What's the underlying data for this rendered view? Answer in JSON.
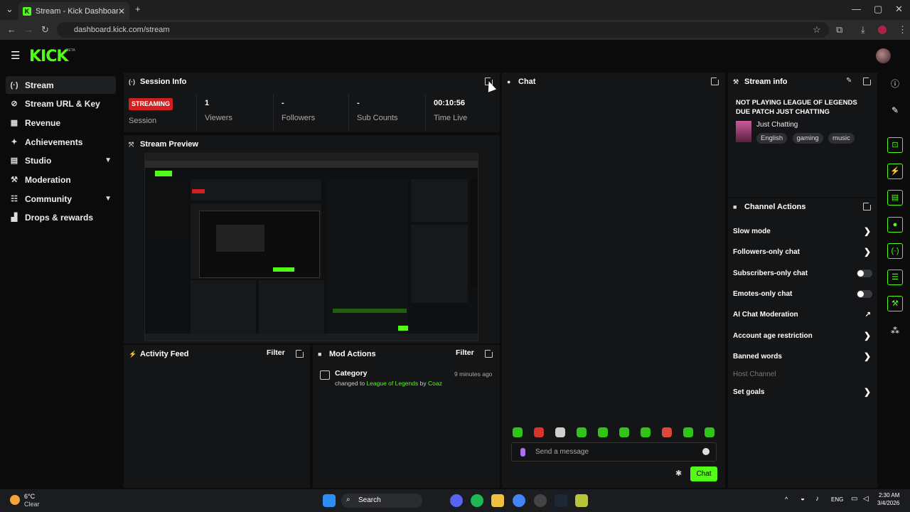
{
  "browser": {
    "tab_title": "Stream - Kick Dashboard",
    "url": "dashboard.kick.com/stream"
  },
  "app": {
    "logo": "KICK",
    "beta": "BETA"
  },
  "sidebar": {
    "items": [
      {
        "label": "Stream",
        "icon": "broadcast-icon"
      },
      {
        "label": "Stream URL & Key",
        "icon": "link-icon"
      },
      {
        "label": "Revenue",
        "icon": "revenue-icon"
      },
      {
        "label": "Achievements",
        "icon": "trophy-icon"
      },
      {
        "label": "Studio",
        "icon": "studio-icon"
      },
      {
        "label": "Moderation",
        "icon": "wrench-icon"
      },
      {
        "label": "Community",
        "icon": "community-icon"
      },
      {
        "label": "Drops & rewards",
        "icon": "gift-icon"
      }
    ]
  },
  "session": {
    "title": "Session Info",
    "status": "STREAMING",
    "status_label": "Session",
    "viewers_value": "1",
    "viewers_label": "Viewers",
    "followers_value": "-",
    "followers_label": "Followers",
    "subs_value": "-",
    "subs_label": "Sub Counts",
    "time_value": "00:10:56",
    "time_label": "Time Live"
  },
  "preview": {
    "title": "Stream Preview"
  },
  "activity": {
    "title": "Activity Feed",
    "filter": "Filter"
  },
  "mod_actions": {
    "title": "Mod Actions",
    "filter": "Filter",
    "entry_title": "Category",
    "entry_time": "9 minutes ago",
    "entry_prefix": "changed to",
    "entry_game": "League of Legends",
    "entry_by": "by",
    "entry_user": "Coaz"
  },
  "chat": {
    "title": "Chat",
    "placeholder": "Send a message",
    "send": "Chat"
  },
  "stream_info": {
    "title": "Stream info",
    "stream_title": "NOT PLAYING LEAGUE OF LEGENDS DUE PATCH JUST CHATTING",
    "category": "Just Chatting",
    "tags": [
      "English",
      "gaming",
      "music"
    ]
  },
  "channel_actions": {
    "title": "Channel Actions",
    "items": [
      {
        "label": "Slow mode",
        "control": "chevron"
      },
      {
        "label": "Followers-only chat",
        "control": "chevron"
      },
      {
        "label": "Subscribers-only chat",
        "control": "toggle"
      },
      {
        "label": "Emotes-only chat",
        "control": "toggle"
      },
      {
        "label": "AI Chat Moderation",
        "control": "external"
      },
      {
        "label": "Account age restriction",
        "control": "chevron"
      },
      {
        "label": "Banned words",
        "control": "chevron"
      },
      {
        "label": "Host Channel",
        "control": "none"
      },
      {
        "label": "Set goals",
        "control": "chevron"
      }
    ]
  },
  "taskbar": {
    "weather_temp": "6°C",
    "weather_desc": "Clear",
    "search": "Search",
    "lang": "ENG",
    "time": "2:30 AM",
    "date": "3/4/2026"
  },
  "colors": {
    "accent": "#53fc18",
    "live": "#d01f1f",
    "panel": "#141517"
  }
}
